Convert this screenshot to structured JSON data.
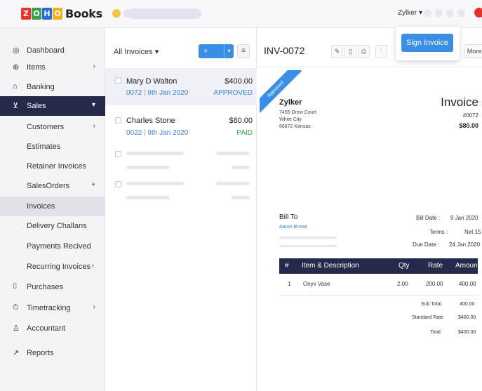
{
  "brand": {
    "logo_letters": [
      {
        "ch": "Z",
        "color": "#e4332b"
      },
      {
        "ch": "O",
        "color": "#3aa34a"
      },
      {
        "ch": "H",
        "color": "#2a6dd2"
      },
      {
        "ch": "O",
        "color": "#f2b01e"
      }
    ],
    "product": "Books"
  },
  "topbar": {
    "org_name": "Zylker ▾"
  },
  "sidebar": {
    "items": [
      {
        "label": "Dashboard",
        "icon": "dashboard-icon",
        "glyph": "◎"
      },
      {
        "label": "Items",
        "icon": "items-icon",
        "glyph": "⊕",
        "trail": "›"
      },
      {
        "label": "Banking",
        "icon": "bank-icon",
        "glyph": "⌂"
      },
      {
        "label": "Sales",
        "icon": "cart-icon",
        "glyph": "⊻",
        "trail": "▾"
      },
      {
        "label": "Customers",
        "trail": "›"
      },
      {
        "label": "Estimates"
      },
      {
        "label": "Retainer Invoices"
      },
      {
        "label": "SalesOrders",
        "trail": "+"
      },
      {
        "label": "Invoices"
      },
      {
        "label": "Delivery Challans"
      },
      {
        "label": "Payments Recived"
      },
      {
        "label": "Recurring Invoices",
        "trail": "›"
      },
      {
        "label": "Purchases",
        "icon": "bag-icon",
        "glyph": "⌷"
      },
      {
        "label": "Timetracking",
        "icon": "stopwatch-icon",
        "glyph": "⏱",
        "trail": "›"
      },
      {
        "label": "Accountant",
        "icon": "accountant-icon",
        "glyph": "♙"
      },
      {
        "label": "Reports",
        "icon": "reports-icon",
        "glyph": "↗"
      }
    ]
  },
  "list": {
    "title": "All Invoices ▾",
    "new_label": "+ New",
    "new_drop": "▾",
    "menu_glyph": "≡",
    "rows": [
      {
        "customer": "Mary D Walton",
        "amount": "$400.00",
        "number": "0072",
        "date": "9th Jan 2020",
        "status": "APPROVED",
        "status_color": "#3b84d6"
      },
      {
        "customer": "Charles Stone",
        "amount": "$80.00",
        "number": "0022",
        "date": "9th Jan 2020",
        "status": "PAID",
        "status_color": "#2ca24b"
      }
    ]
  },
  "detail": {
    "invoice_no": "INV-0072",
    "tools": [
      "✎",
      "▯",
      "⎙",
      "⫶"
    ],
    "sign_label": "Sign Invoice",
    "more_label": "More",
    "ribbon": "Approved",
    "company": {
      "name": "Zylker",
      "address1": "7455 Drew Court",
      "address2": "White City",
      "address3": "66872 Kansas"
    },
    "doc_title": "Invoice",
    "doc_number": "#0072",
    "doc_amount": "$80.00",
    "bill_to_label": "Bill To",
    "bill_to_name": "Aaron Brown",
    "bill_date_label": "Bill Date :",
    "bill_date": "9 Jan 2020",
    "terms_label": "Terms :",
    "terms": "Net 15",
    "due_date_label": "Due Date :",
    "due_date": "24 Jan 2020",
    "table": {
      "headers": {
        "num": "#",
        "item": "Item & Description",
        "qty": "Qty",
        "rate": "Rate",
        "amount": "Amount"
      },
      "row": {
        "num": "1",
        "item": "Onyx Vase",
        "qty": "2.00",
        "rate": "200.00",
        "amount": "400.00"
      }
    },
    "sub_total_label": "Sub Total",
    "sub_total": "400.00",
    "standard_rate_label": "Standard Rate",
    "standard_rate": "$400.00",
    "total_label": "Total",
    "total": "$400.00"
  }
}
